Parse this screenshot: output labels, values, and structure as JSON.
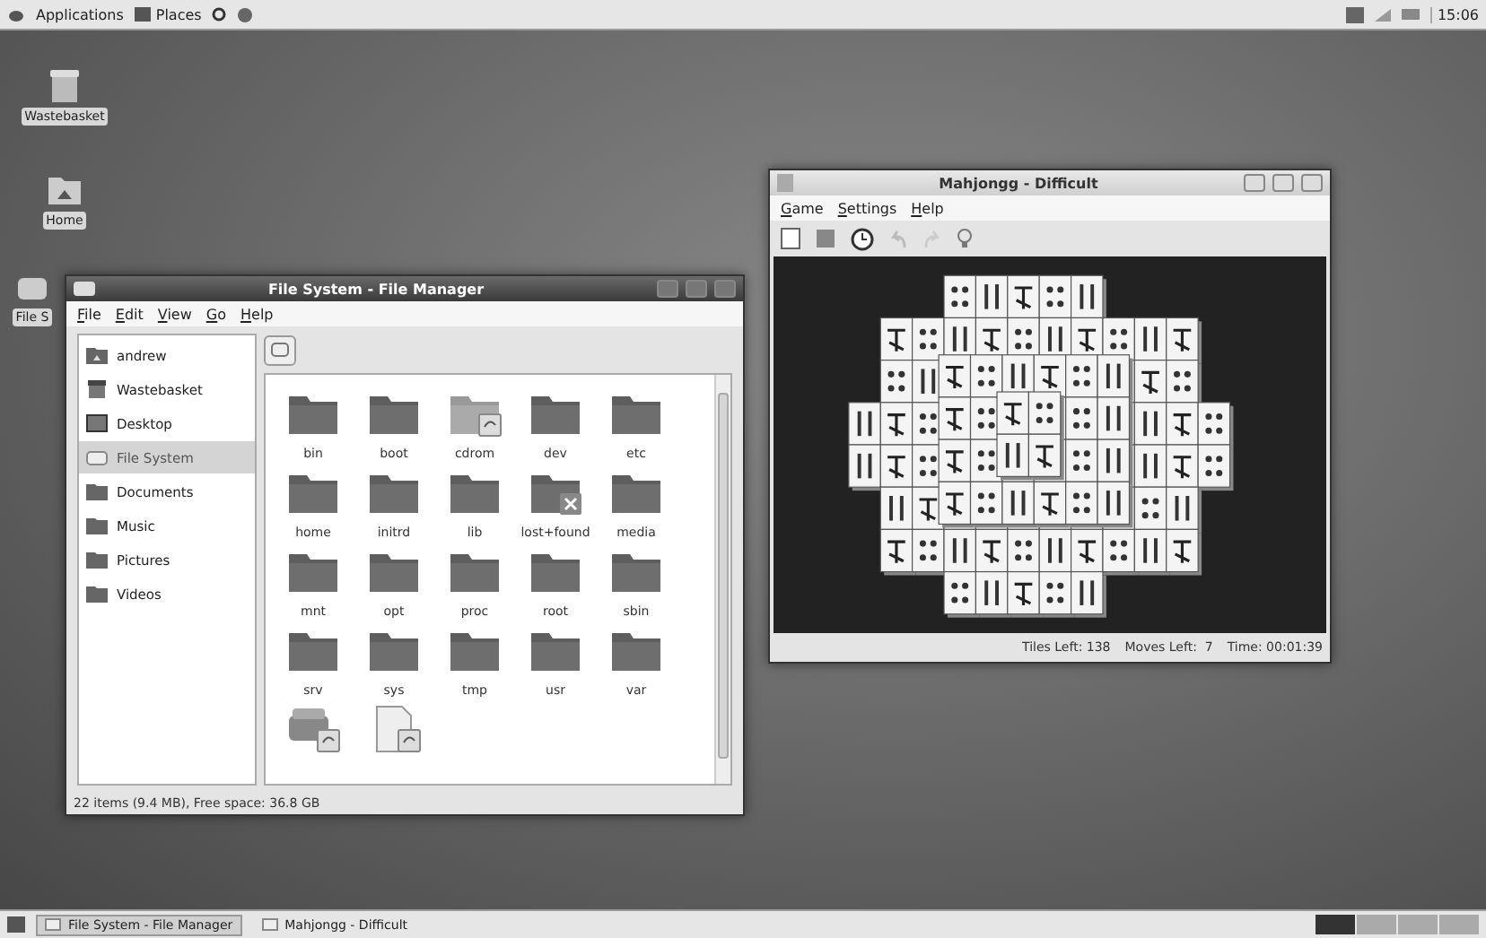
{
  "top_panel": {
    "menus": [
      "Applications",
      "Places"
    ],
    "clock": "15:06"
  },
  "desktop_icons": [
    {
      "label": "Wastebasket",
      "kind": "trash"
    },
    {
      "label": "Home",
      "kind": "home"
    },
    {
      "label": "File S",
      "kind": "drive"
    }
  ],
  "file_manager": {
    "title": "File System - File Manager",
    "menu": [
      "File",
      "Edit",
      "View",
      "Go",
      "Help"
    ],
    "places": [
      {
        "label": "andrew",
        "kind": "home",
        "selected": false
      },
      {
        "label": "Wastebasket",
        "kind": "trash",
        "selected": false
      },
      {
        "label": "Desktop",
        "kind": "desktop",
        "selected": false
      },
      {
        "label": "File System",
        "kind": "drive",
        "selected": true
      },
      {
        "label": "Documents",
        "kind": "folder",
        "selected": false
      },
      {
        "label": "Music",
        "kind": "folder",
        "selected": false
      },
      {
        "label": "Pictures",
        "kind": "folder",
        "selected": false
      },
      {
        "label": "Videos",
        "kind": "folder",
        "selected": false
      }
    ],
    "items": [
      {
        "name": "bin",
        "kind": "folder"
      },
      {
        "name": "boot",
        "kind": "folder"
      },
      {
        "name": "cdrom",
        "kind": "link"
      },
      {
        "name": "dev",
        "kind": "folder"
      },
      {
        "name": "etc",
        "kind": "folder"
      },
      {
        "name": "home",
        "kind": "folder"
      },
      {
        "name": "initrd",
        "kind": "folder"
      },
      {
        "name": "lib",
        "kind": "folder"
      },
      {
        "name": "lost+found",
        "kind": "locked"
      },
      {
        "name": "media",
        "kind": "folder"
      },
      {
        "name": "mnt",
        "kind": "folder"
      },
      {
        "name": "opt",
        "kind": "folder"
      },
      {
        "name": "proc",
        "kind": "folder"
      },
      {
        "name": "root",
        "kind": "folder"
      },
      {
        "name": "sbin",
        "kind": "folder"
      },
      {
        "name": "srv",
        "kind": "folder"
      },
      {
        "name": "sys",
        "kind": "folder"
      },
      {
        "name": "tmp",
        "kind": "folder"
      },
      {
        "name": "usr",
        "kind": "folder"
      },
      {
        "name": "var",
        "kind": "folder"
      },
      {
        "kind": "drive-link"
      },
      {
        "kind": "file-link"
      }
    ],
    "status": "22 items (9.4 MB), Free space: 36.8 GB"
  },
  "mahjongg": {
    "title": "Mahjongg - Difficult",
    "menu": [
      "Game",
      "Settings",
      "Help"
    ],
    "status": [
      "Tiles Left: 138",
      "Moves Left:  7",
      "Time: 00:01:39"
    ]
  },
  "taskbar": {
    "tasks": [
      {
        "label": "File System - File Manager",
        "selected": true
      },
      {
        "label": "Mahjongg - Difficult",
        "selected": false
      }
    ]
  }
}
